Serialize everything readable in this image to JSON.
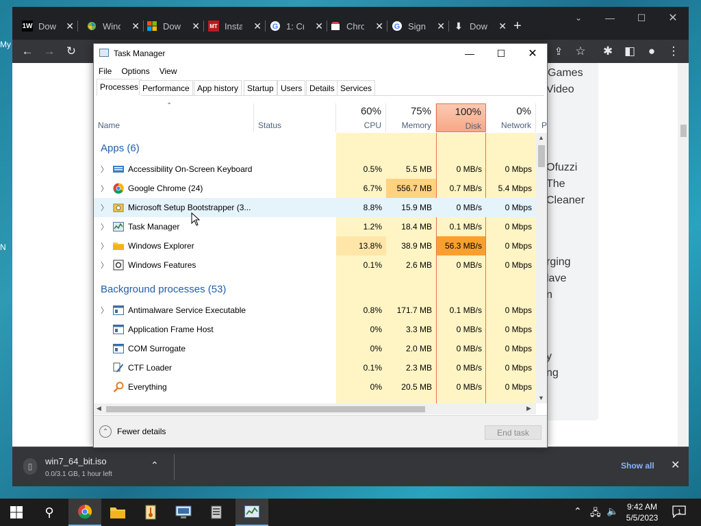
{
  "desktop": {
    "left_labels": [
      "My",
      "N"
    ]
  },
  "chrome": {
    "tabs": [
      {
        "icon": "tw-logo-icon",
        "title": "Dow"
      },
      {
        "icon": "windows-pinwheel-icon",
        "title": "Wind"
      },
      {
        "icon": "microsoft-logo-icon",
        "title": "Dow"
      },
      {
        "icon": "mt-logo-icon",
        "title": "Insta"
      },
      {
        "icon": "google-logo-icon",
        "title": "1: Cr"
      },
      {
        "icon": "chrome-store-icon",
        "title": "Chro"
      },
      {
        "icon": "google-logo-icon",
        "title": "Sign"
      },
      {
        "icon": "download-icon",
        "title": "Dow"
      }
    ],
    "fav_text": [
      "1W",
      "",
      "",
      "MT",
      "",
      "",
      "",
      ""
    ],
    "page_text": [
      "Games",
      "Video",
      "Ofuzzi",
      "The",
      "Cleaner",
      "rging",
      "lave",
      "n",
      "y",
      "ng"
    ]
  },
  "download": {
    "filename": "win7_64_bit.iso",
    "status": "0.0/3.1 GB, 1 hour left",
    "show_all": "Show all"
  },
  "task_manager": {
    "title": "Task Manager",
    "menu": [
      "File",
      "Options",
      "View"
    ],
    "tabs": [
      "Processes",
      "Performance",
      "App history",
      "Startup",
      "Users",
      "Details",
      "Services"
    ],
    "columns": {
      "name": "Name",
      "status": "Status",
      "cpu": {
        "pct": "60%",
        "label": "CPU"
      },
      "memory": {
        "pct": "75%",
        "label": "Memory"
      },
      "disk": {
        "pct": "100%",
        "label": "Disk"
      },
      "network": {
        "pct": "0%",
        "label": "Network"
      },
      "next": "P"
    },
    "groups": [
      {
        "title": "Apps (6)",
        "rows": [
          {
            "name": "Accessibility On-Screen Keyboard",
            "cpu": "0.5%",
            "mem": "5.5 MB",
            "disk": "0 MB/s",
            "net": "0 Mbps",
            "expand": true,
            "icon": "keyboard-icon"
          },
          {
            "name": "Google Chrome (24)",
            "cpu": "6.7%",
            "mem": "556.7 MB",
            "disk": "0.7 MB/s",
            "net": "5.4 Mbps",
            "expand": true,
            "icon": "chrome-icon"
          },
          {
            "name": "Microsoft Setup Bootstrapper (3...",
            "cpu": "8.8%",
            "mem": "15.9 MB",
            "disk": "0 MB/s",
            "net": "0 Mbps",
            "expand": true,
            "icon": "setup-icon"
          },
          {
            "name": "Task Manager",
            "cpu": "1.2%",
            "mem": "18.4 MB",
            "disk": "0.1 MB/s",
            "net": "0 Mbps",
            "expand": true,
            "icon": "task-manager-icon"
          },
          {
            "name": "Windows Explorer",
            "cpu": "13.8%",
            "mem": "38.9 MB",
            "disk": "56.3 MB/s",
            "net": "0 Mbps",
            "expand": true,
            "icon": "folder-icon"
          },
          {
            "name": "Windows Features",
            "cpu": "0.1%",
            "mem": "2.6 MB",
            "disk": "0 MB/s",
            "net": "0 Mbps",
            "expand": true,
            "icon": "features-icon"
          }
        ]
      },
      {
        "title": "Background processes (53)",
        "rows": [
          {
            "name": "Antimalware Service Executable",
            "cpu": "0.8%",
            "mem": "171.7 MB",
            "disk": "0.1 MB/s",
            "net": "0 Mbps",
            "expand": true,
            "icon": "service-icon"
          },
          {
            "name": "Application Frame Host",
            "cpu": "0%",
            "mem": "3.3 MB",
            "disk": "0 MB/s",
            "net": "0 Mbps",
            "expand": false,
            "icon": "service-icon"
          },
          {
            "name": "COM Surrogate",
            "cpu": "0%",
            "mem": "2.0 MB",
            "disk": "0 MB/s",
            "net": "0 Mbps",
            "expand": false,
            "icon": "service-icon"
          },
          {
            "name": "CTF Loader",
            "cpu": "0.1%",
            "mem": "2.3 MB",
            "disk": "0 MB/s",
            "net": "0 Mbps",
            "expand": false,
            "icon": "ctf-pen-icon"
          },
          {
            "name": "Everything",
            "cpu": "0%",
            "mem": "20.5 MB",
            "disk": "0 MB/s",
            "net": "0 Mbps",
            "expand": false,
            "icon": "magnifier-icon"
          }
        ]
      }
    ],
    "footer": {
      "fewer_details": "Fewer details",
      "end_task": "End task"
    }
  },
  "taskbar": {
    "clock_time": "9:42 AM",
    "clock_date": "5/5/2023",
    "notification_count": "1",
    "apps": [
      "chrome-icon",
      "file-explorer-icon",
      "media-icon",
      "remote-desktop-icon",
      "server-manager-icon",
      "task-manager-icon"
    ]
  }
}
